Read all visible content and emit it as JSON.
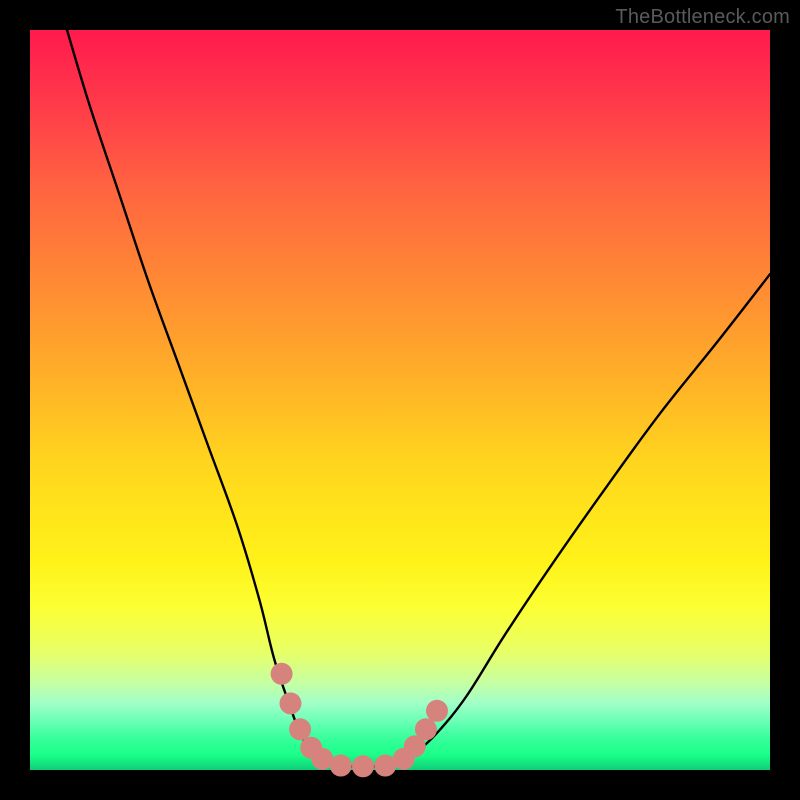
{
  "attribution": "TheBottleneck.com",
  "chart_data": {
    "type": "line",
    "title": "",
    "xlabel": "",
    "ylabel": "",
    "xlim": [
      0,
      100
    ],
    "ylim": [
      0,
      100
    ],
    "grid": false,
    "legend": false,
    "series": [
      {
        "name": "left-falling-curve",
        "x": [
          5,
          8,
          12,
          16,
          20,
          24,
          28,
          31,
          33,
          35,
          36.5,
          38,
          39.5
        ],
        "values": [
          100,
          90,
          78,
          66,
          55,
          44,
          33,
          23,
          15,
          9,
          5,
          2.5,
          1.2
        ]
      },
      {
        "name": "valley-floor",
        "x": [
          39.5,
          41,
          43,
          45,
          47,
          49,
          50.5
        ],
        "values": [
          1.2,
          0.7,
          0.5,
          0.5,
          0.5,
          0.7,
          1.2
        ]
      },
      {
        "name": "right-rising-curve",
        "x": [
          50.5,
          52,
          55,
          59,
          64,
          70,
          77,
          85,
          93,
          100
        ],
        "values": [
          1.2,
          2.2,
          5,
          10,
          18,
          27,
          37,
          48,
          58,
          67
        ]
      }
    ],
    "markers": [
      {
        "name": "marker-left-1",
        "x": 34.0,
        "y": 13.0
      },
      {
        "name": "marker-left-2",
        "x": 35.2,
        "y": 9.0
      },
      {
        "name": "marker-left-3",
        "x": 36.5,
        "y": 5.5
      },
      {
        "name": "marker-left-4",
        "x": 38.0,
        "y": 3.0
      },
      {
        "name": "marker-left-5",
        "x": 39.5,
        "y": 1.5
      },
      {
        "name": "marker-floor-1",
        "x": 42.0,
        "y": 0.6
      },
      {
        "name": "marker-floor-2",
        "x": 45.0,
        "y": 0.5
      },
      {
        "name": "marker-floor-3",
        "x": 48.0,
        "y": 0.6
      },
      {
        "name": "marker-right-1",
        "x": 50.5,
        "y": 1.5
      },
      {
        "name": "marker-right-2",
        "x": 52.0,
        "y": 3.2
      },
      {
        "name": "marker-right-3",
        "x": 53.5,
        "y": 5.5
      },
      {
        "name": "marker-right-4",
        "x": 55.0,
        "y": 8.0
      }
    ],
    "colors": {
      "curve": "#000000",
      "marker_fill": "#d6837e",
      "gradient_top": "#ff1a4d",
      "gradient_bottom": "#0fce78",
      "frame": "#000000"
    }
  }
}
